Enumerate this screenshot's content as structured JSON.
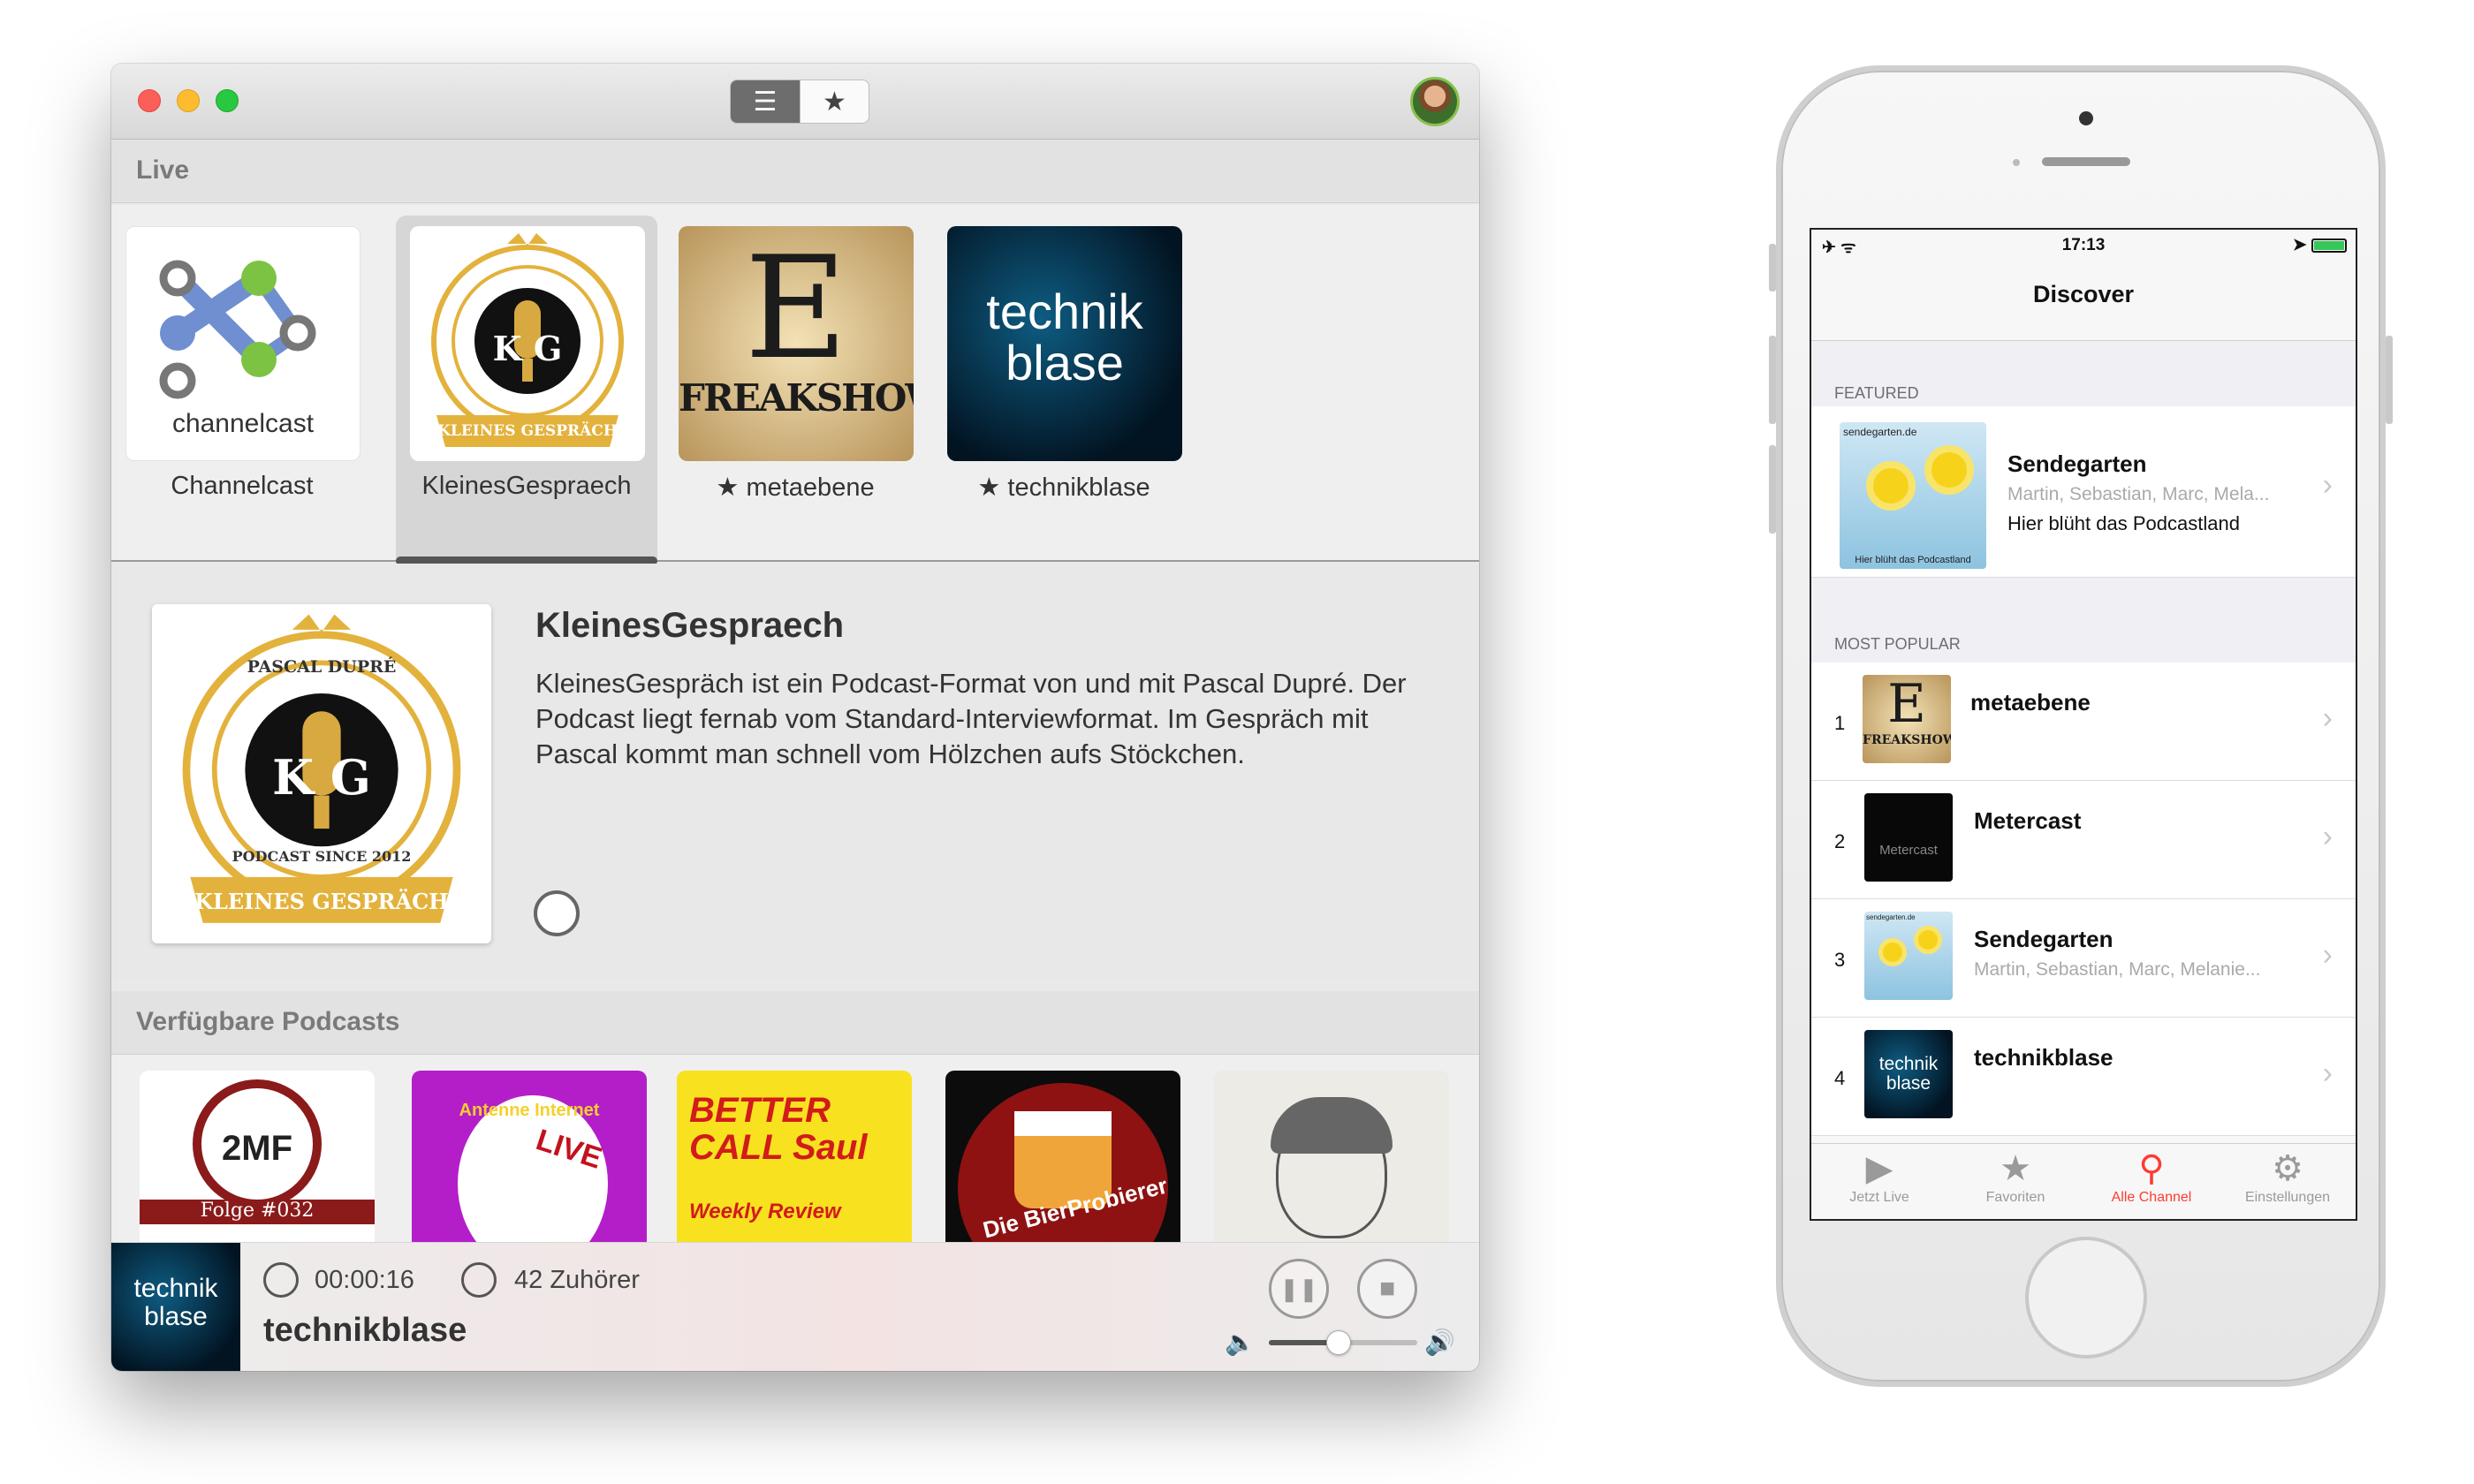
{
  "mac": {
    "toolbar": {
      "list_icon": "☰",
      "favorites_icon": "★"
    },
    "live": {
      "header": "Live",
      "tiles": [
        {
          "label": "Channelcast",
          "art_text": "channelcast"
        },
        {
          "label": "KleinesGespraech",
          "art_text": "KLEINES GESPRÄCH"
        },
        {
          "label": "★ metaebene",
          "art_text": "FREAKSHOW"
        },
        {
          "label": "★ technikblase",
          "art_text": "technik blase"
        }
      ]
    },
    "detail": {
      "title": "KleinesGespraech",
      "description": "KleinesGespräch ist ein Podcast-Format von und mit Pascal Dupré. Der Podcast liegt fernab vom Standard-Interviewformat. Im Gespräch mit Pascal kommt man schnell vom Hölzchen aufs Stöckchen.",
      "art_top": "PASCAL DUPRÉ",
      "art_mid": "K G",
      "art_ring": "PODCAST SINCE 2012",
      "art_ribbon": "KLEINES GESPRÄCH"
    },
    "available": {
      "header": "Verfügbare Podcasts",
      "tiles": [
        {
          "art_text": "2MF",
          "caption": "Folge #032"
        },
        {
          "art_text": "Antenne Internet",
          "caption": "LIVE"
        },
        {
          "art_text": "BETTER CALL Saul",
          "caption": "Weekly Review"
        },
        {
          "art_text": "Die BierProbierer",
          "caption": ""
        },
        {
          "art_text": "",
          "caption": ""
        }
      ]
    },
    "player": {
      "art_text": "technik blase",
      "elapsed": "00:00:16",
      "listeners": "42 Zuhörer",
      "title": "technikblase",
      "pause_icon": "❚❚",
      "stop_icon": "■",
      "volume_low_icon": "🔈",
      "volume_high_icon": "🔊",
      "volume_level": 0.47
    }
  },
  "phone": {
    "status": {
      "left": "✈ ᯤ",
      "time": "17:13",
      "right": "➤"
    },
    "nav_title": "Discover",
    "featured_header": "FEATURED",
    "featured": {
      "title": "Sendegarten",
      "subtitle": "Martin, Sebastian, Marc, Mela...",
      "tagline": "Hier blüht das Podcastland",
      "art_top": "sendegarten.de",
      "art_bottom": "Hier blüht das Podcastland"
    },
    "popular_header": "MOST POPULAR",
    "popular": [
      {
        "rank": "1",
        "title": "metaebene",
        "subtitle": "",
        "art_text": "FREAKSHOW"
      },
      {
        "rank": "2",
        "title": "Metercast",
        "subtitle": "",
        "art_text": "Metercast"
      },
      {
        "rank": "3",
        "title": "Sendegarten",
        "subtitle": "Martin, Sebastian, Marc, Melanie...",
        "art_text": "sendegarten.de"
      },
      {
        "rank": "4",
        "title": "technikblase",
        "subtitle": "",
        "art_text": "technik blase"
      }
    ],
    "chevron": "›",
    "tabs": [
      {
        "label": "Jetzt Live",
        "icon": "▶"
      },
      {
        "label": "Favoriten",
        "icon": "★"
      },
      {
        "label": "Alle Channel",
        "icon": "⚲"
      },
      {
        "label": "Einstellungen",
        "icon": "⚙"
      }
    ],
    "active_tab": "Alle Channel"
  },
  "colors": {
    "accent_red": "#ff3b30",
    "traffic_red": "#fc5f57",
    "traffic_yellow": "#fdbc2e",
    "traffic_green": "#28c840"
  }
}
